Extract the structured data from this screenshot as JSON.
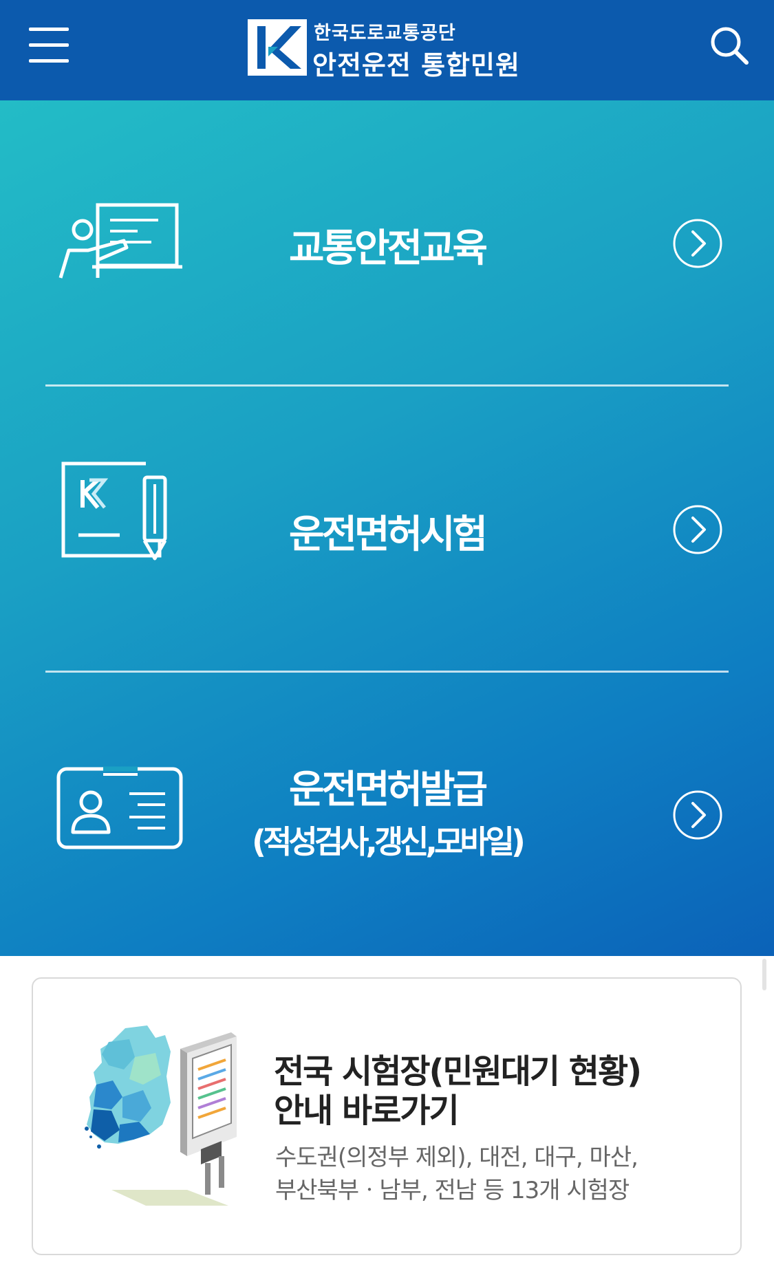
{
  "header": {
    "org_name": "한국도로교통공단",
    "service_name": "안전운전 통합민원",
    "menu_icon": "hamburger-menu-icon",
    "search_icon": "search-icon",
    "bg_color": "#0c5aad"
  },
  "menu": {
    "items": [
      {
        "title": "교통안전교육",
        "subtitle": "",
        "icon": "teacher-board-icon"
      },
      {
        "title": "운전면허시험",
        "subtitle": "",
        "icon": "exam-paper-pencil-icon"
      },
      {
        "title": "운전면허발급",
        "subtitle": "(적성검사,갱신,모바일)",
        "icon": "license-card-icon"
      }
    ],
    "arrow_icon": "circle-chevron-right-icon",
    "gradient": [
      "#23bcc6",
      "#0b62b8"
    ]
  },
  "banner": {
    "title_line1": "전국 시험장(민원대기 현황)",
    "title_line2": "안내 바로가기",
    "desc_line1": "수도권(의정부 제외), 대전, 대구, 마산,",
    "desc_line2": "부산북부ㆍ남부, 전남 등 13개 시험장",
    "illustration": "korea-map-kiosk-illustration"
  }
}
